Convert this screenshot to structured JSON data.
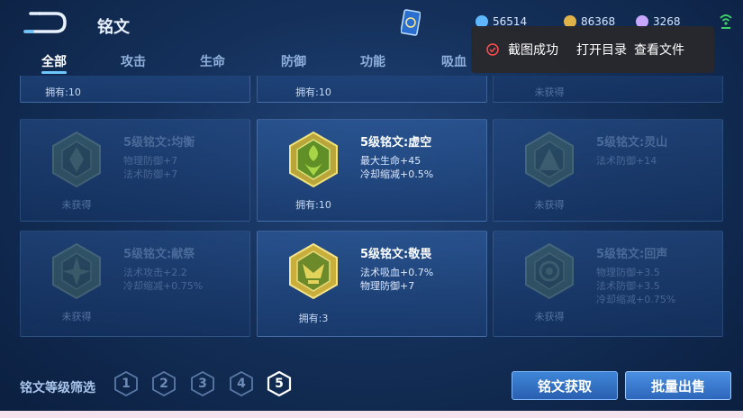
{
  "header": {
    "title": "铭文",
    "currencies": [
      {
        "icon": "blue-gem-icon",
        "value": "56514",
        "color": "#5fb8ff"
      },
      {
        "icon": "gold-coin-icon",
        "value": "86368",
        "color": "#e0b24a"
      },
      {
        "icon": "purple-crystal-icon",
        "value": "3268",
        "color": "#c9a6ff"
      }
    ]
  },
  "tabs": [
    {
      "label": "全部",
      "active": true
    },
    {
      "label": "攻击"
    },
    {
      "label": "生命"
    },
    {
      "label": "防御"
    },
    {
      "label": "功能"
    },
    {
      "label": "吸血"
    }
  ],
  "toast": {
    "message": "截图成功",
    "open_dir": "打开目录",
    "view_file": "查看文件"
  },
  "cards": [
    {
      "name": "",
      "stats": [],
      "status": "拥有:10",
      "owned": true
    },
    {
      "name": "",
      "stats": [],
      "status": "拥有:10",
      "owned": true
    },
    {
      "name": "",
      "stats": [],
      "status": "未获得",
      "owned": false
    },
    {
      "name": "5级铭文:均衡",
      "stats": [
        "物理防御+7",
        "法术防御+7"
      ],
      "status": "未获得",
      "owned": false,
      "color": "#6a8a5a"
    },
    {
      "name": "5级铭文:虚空",
      "stats": [
        "最大生命+45",
        "冷却缩减+0.5%"
      ],
      "status": "拥有:10",
      "owned": true,
      "color": "#8db33a"
    },
    {
      "name": "5级铭文:灵山",
      "stats": [
        "法术防御+14"
      ],
      "status": "未获得",
      "owned": false,
      "color": "#6a8a5a"
    },
    {
      "name": "5级铭文:献祭",
      "stats": [
        "法术攻击+2.2",
        "冷却缩减+0.75%"
      ],
      "status": "未获得",
      "owned": false,
      "color": "#6a8a5a"
    },
    {
      "name": "5级铭文:敬畏",
      "stats": [
        "法术吸血+0.7%",
        "物理防御+7"
      ],
      "status": "拥有:3",
      "owned": true,
      "color": "#a8a23a"
    },
    {
      "name": "5级铭文:回声",
      "stats": [
        "物理防御+3.5",
        "法术防御+3.5",
        "冷却缩减+0.75%"
      ],
      "status": "未获得",
      "owned": false,
      "color": "#6a8a5a"
    }
  ],
  "footer": {
    "filter_label": "铭文等级筛选",
    "levels": [
      "1",
      "2",
      "3",
      "4",
      "5"
    ],
    "selected_level": "5",
    "get_button": "铭文获取",
    "sell_button": "批量出售"
  }
}
